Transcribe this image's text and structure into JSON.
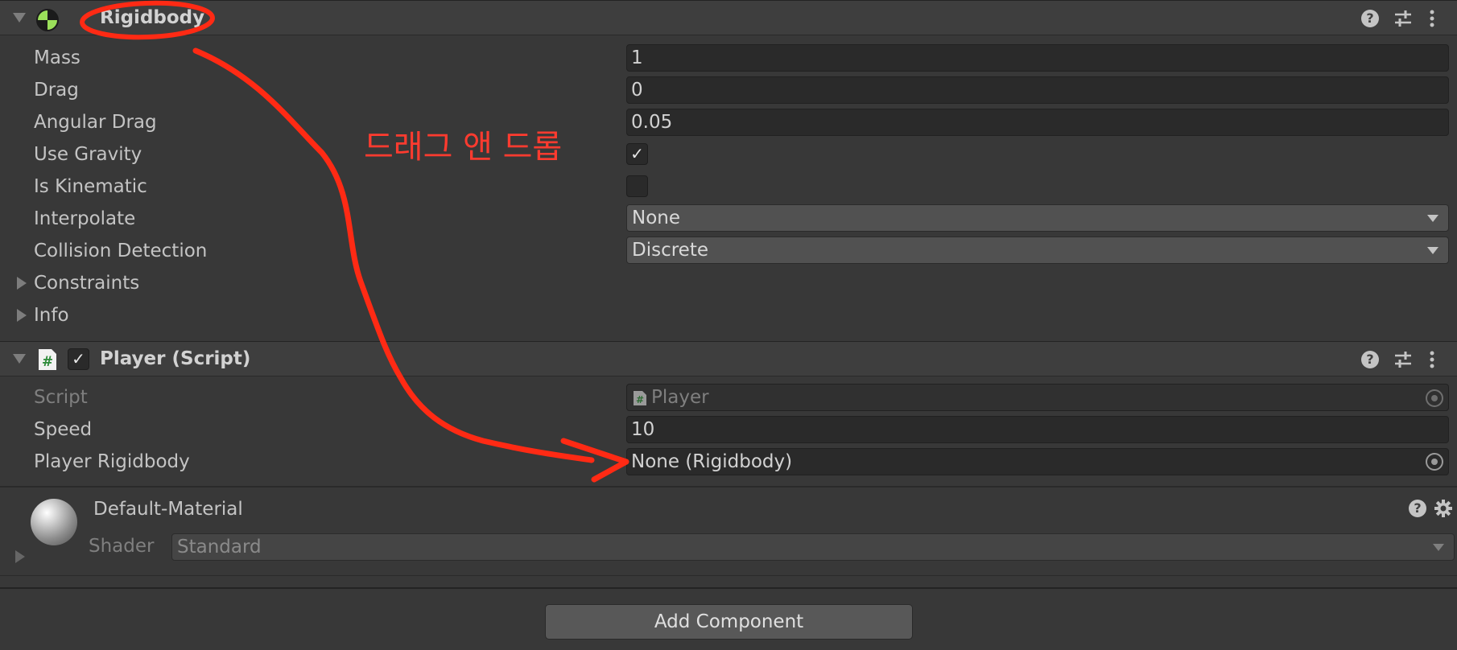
{
  "rigidbody": {
    "title": "Rigidbody",
    "fields": [
      {
        "label": "Mass",
        "value": "1"
      },
      {
        "label": "Drag",
        "value": "0"
      },
      {
        "label": "Angular Drag",
        "value": "0.05"
      }
    ],
    "use_gravity_label": "Use Gravity",
    "use_gravity_checked": true,
    "is_kinematic_label": "Is Kinematic",
    "is_kinematic_checked": false,
    "interpolate_label": "Interpolate",
    "interpolate_value": "None",
    "collision_label": "Collision Detection",
    "collision_value": "Discrete",
    "constraints_label": "Constraints",
    "info_label": "Info"
  },
  "player_script": {
    "title": "Player (Script)",
    "enabled": true,
    "script_label": "Script",
    "script_value": "Player",
    "speed_label": "Speed",
    "speed_value": "10",
    "rigidbody_label": "Player Rigidbody",
    "rigidbody_value": "None (Rigidbody)"
  },
  "material": {
    "name": "Default-Material",
    "shader_label": "Shader",
    "shader_value": "Standard"
  },
  "add_component_label": "Add Component",
  "annotation": {
    "text": "드래그 앤 드롭",
    "color": "#ff3b2f"
  },
  "icons": {
    "rigidbody": "rigidbody-icon",
    "script": "csharp-script-icon",
    "help": "help-icon",
    "presets": "presets-icon",
    "menu": "kebab-menu-icon",
    "settings": "gear-icon",
    "object_picker": "object-picker-icon"
  }
}
